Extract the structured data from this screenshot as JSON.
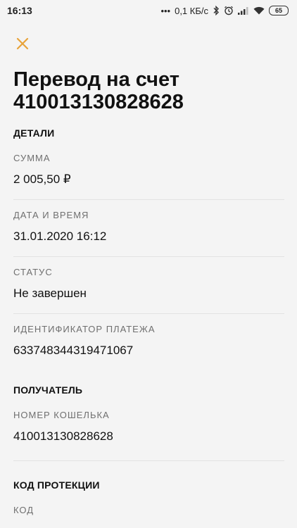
{
  "status_bar": {
    "time": "16:13",
    "dots": "•••",
    "speed": "0,1 КБ/с",
    "battery": "65"
  },
  "header": {
    "title": "Перевод на счет 410013130828628"
  },
  "details": {
    "section_title": "ДЕТАЛИ",
    "fields": [
      {
        "label": "СУММА",
        "value": "2 005,50 ₽"
      },
      {
        "label": "ДАТА И ВРЕМЯ",
        "value": "31.01.2020 16:12"
      },
      {
        "label": "СТАТУС",
        "value": "Не завершен"
      },
      {
        "label": "ИДЕНТИФИКАТОР ПЛАТЕЖА",
        "value": "633748344319471067"
      }
    ]
  },
  "recipient": {
    "section_title": "ПОЛУЧАТЕЛЬ",
    "fields": [
      {
        "label": "НОМЕР КОШЕЛЬКА",
        "value": "410013130828628"
      }
    ]
  },
  "protection": {
    "section_title": "КОД ПРОТЕКЦИИ",
    "fields": [
      {
        "label": "КОД",
        "value": ""
      }
    ]
  },
  "colors": {
    "accent": "#e8a33a",
    "background": "#f4f4f4",
    "divider": "#e2e2e2",
    "label": "#6f6f6f"
  }
}
